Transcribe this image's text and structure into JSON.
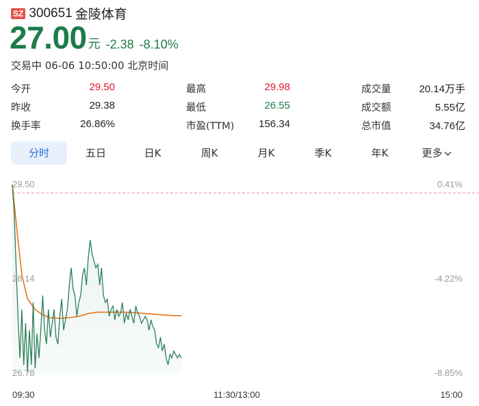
{
  "header": {
    "market_badge": "SZ",
    "code": "300651",
    "name": "金陵体育"
  },
  "quote": {
    "price": "27.00",
    "unit": "元",
    "change": "-2.38",
    "change_pct": "-8.10%",
    "status": "交易中 06-06 10:50:00 北京时间"
  },
  "stats": [
    [
      {
        "label": "今开",
        "value": "29.50",
        "color": "red"
      },
      {
        "label": "最高",
        "value": "29.98",
        "color": "red"
      },
      {
        "label": "成交量",
        "value": "20.14万手",
        "color": "normal"
      }
    ],
    [
      {
        "label": "昨收",
        "value": "29.38",
        "color": "normal"
      },
      {
        "label": "最低",
        "value": "26.55",
        "color": "green"
      },
      {
        "label": "成交额",
        "value": "5.55亿",
        "color": "normal"
      }
    ],
    [
      {
        "label": "换手率",
        "value": "26.86%",
        "color": "normal"
      },
      {
        "label": "市盈(TTM)",
        "value": "156.34",
        "color": "normal"
      },
      {
        "label": "总市值",
        "value": "34.76亿",
        "color": "normal"
      }
    ]
  ],
  "tabs": [
    {
      "label": "分时",
      "active": true
    },
    {
      "label": "五日",
      "active": false
    },
    {
      "label": "日K",
      "active": false
    },
    {
      "label": "周K",
      "active": false
    },
    {
      "label": "月K",
      "active": false
    },
    {
      "label": "季K",
      "active": false
    },
    {
      "label": "年K",
      "active": false
    },
    {
      "label": "更多",
      "active": false,
      "icon": "chevron-down-icon"
    }
  ],
  "colors": {
    "up": "#e0182d",
    "down": "#1d7b4a",
    "price_line": "#2a7f5a",
    "avg_line": "#e8751a",
    "prev_close_line": "#e88a8a",
    "active_tab_bg": "#e8f0fb",
    "active_tab_text": "#2c6fd1"
  },
  "chart_data": {
    "type": "line",
    "y_left_ticks": [
      "29.50",
      "28.14",
      "26.78"
    ],
    "y_right_ticks": [
      "0.41%",
      "-4.22%",
      "-8.85%"
    ],
    "x_ticks": [
      "09:30",
      "11:30/13:00",
      "15:00"
    ],
    "ylim": [
      26.78,
      29.5
    ],
    "prev_close": 29.38,
    "x_range_minutes": [
      0,
      240
    ],
    "series": [
      {
        "kind": "price",
        "points": [
          [
            0,
            29.5
          ],
          [
            1,
            29.1
          ],
          [
            2,
            28.3
          ],
          [
            3,
            27.6
          ],
          [
            4,
            27.0
          ],
          [
            5,
            27.7
          ],
          [
            6,
            26.9
          ],
          [
            7,
            27.5
          ],
          [
            8,
            26.8
          ],
          [
            9,
            27.4
          ],
          [
            10,
            26.9
          ],
          [
            11,
            27.8
          ],
          [
            12,
            26.85
          ],
          [
            13,
            27.35
          ],
          [
            14,
            27.0
          ],
          [
            15,
            27.4
          ],
          [
            16,
            27.9
          ],
          [
            17,
            27.4
          ],
          [
            18,
            27.2
          ],
          [
            19,
            27.7
          ],
          [
            20,
            27.3
          ],
          [
            21,
            27.5
          ],
          [
            22,
            27.7
          ],
          [
            23,
            27.3
          ],
          [
            24,
            27.2
          ],
          [
            25,
            27.6
          ],
          [
            26,
            27.85
          ],
          [
            27,
            27.4
          ],
          [
            28,
            27.55
          ],
          [
            29,
            27.7
          ],
          [
            30,
            28.05
          ],
          [
            31,
            28.3
          ],
          [
            32,
            28.0
          ],
          [
            33,
            27.9
          ],
          [
            34,
            27.6
          ],
          [
            35,
            27.8
          ],
          [
            36,
            27.9
          ],
          [
            37,
            28.2
          ],
          [
            38,
            28.3
          ],
          [
            39,
            28.05
          ],
          [
            40,
            28.45
          ],
          [
            41,
            28.7
          ],
          [
            42,
            28.5
          ],
          [
            43,
            28.4
          ],
          [
            44,
            28.3
          ],
          [
            45,
            28.35
          ],
          [
            46,
            28.05
          ],
          [
            47,
            28.3
          ],
          [
            48,
            27.9
          ],
          [
            49,
            27.8
          ],
          [
            50,
            27.85
          ],
          [
            51,
            27.6
          ],
          [
            52,
            27.7
          ],
          [
            53,
            27.75
          ],
          [
            54,
            27.55
          ],
          [
            55,
            27.7
          ],
          [
            56,
            27.6
          ],
          [
            57,
            27.65
          ],
          [
            58,
            27.8
          ],
          [
            59,
            27.5
          ],
          [
            60,
            27.65
          ],
          [
            61,
            27.55
          ],
          [
            62,
            27.7
          ],
          [
            63,
            27.6
          ],
          [
            64,
            27.5
          ],
          [
            65,
            27.75
          ],
          [
            66,
            27.65
          ],
          [
            67,
            27.6
          ],
          [
            68,
            27.5
          ],
          [
            69,
            27.55
          ],
          [
            70,
            27.6
          ],
          [
            71,
            27.55
          ],
          [
            72,
            27.4
          ],
          [
            73,
            27.55
          ],
          [
            74,
            27.45
          ],
          [
            75,
            27.4
          ],
          [
            76,
            27.2
          ],
          [
            77,
            27.15
          ],
          [
            78,
            27.3
          ],
          [
            79,
            27.1
          ],
          [
            80,
            27.2
          ],
          [
            81,
            27.0
          ],
          [
            82,
            26.9
          ],
          [
            83,
            27.05
          ],
          [
            84,
            27.0
          ],
          [
            85,
            27.1
          ],
          [
            86,
            27.05
          ],
          [
            87,
            27.0
          ],
          [
            88,
            27.05
          ],
          [
            89,
            27.0
          ]
        ]
      },
      {
        "kind": "average",
        "points": [
          [
            0,
            29.5
          ],
          [
            3,
            28.7
          ],
          [
            5,
            28.2
          ],
          [
            8,
            27.85
          ],
          [
            12,
            27.7
          ],
          [
            16,
            27.62
          ],
          [
            20,
            27.58
          ],
          [
            25,
            27.57
          ],
          [
            30,
            27.58
          ],
          [
            35,
            27.6
          ],
          [
            40,
            27.64
          ],
          [
            45,
            27.66
          ],
          [
            50,
            27.66
          ],
          [
            55,
            27.66
          ],
          [
            60,
            27.66
          ],
          [
            65,
            27.65
          ],
          [
            70,
            27.64
          ],
          [
            75,
            27.63
          ],
          [
            80,
            27.62
          ],
          [
            85,
            27.61
          ],
          [
            89,
            27.61
          ]
        ]
      }
    ]
  }
}
